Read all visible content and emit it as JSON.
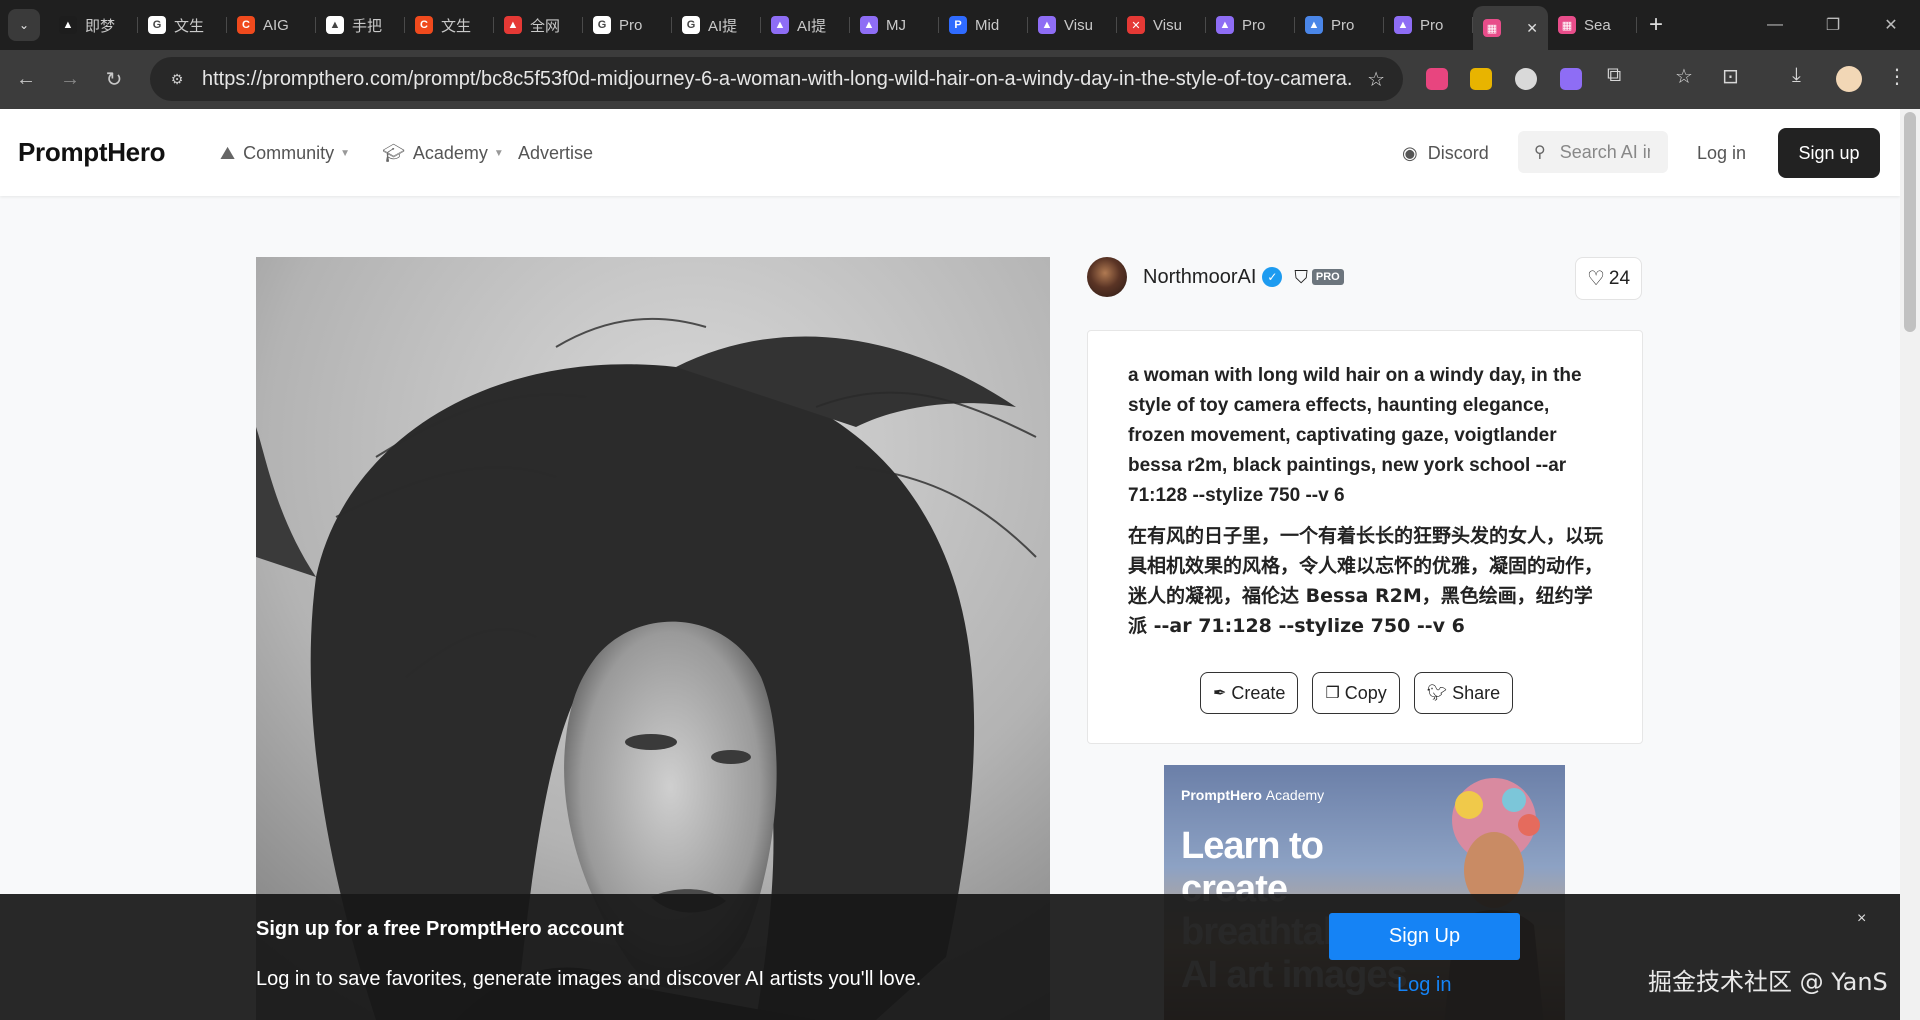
{
  "browser": {
    "tabs": [
      {
        "label": "即梦",
        "icon": "jimeng-icon",
        "color": "#1d1d1d"
      },
      {
        "label": "文生",
        "icon": "google-icon",
        "color": "#ffffff"
      },
      {
        "label": "AIG",
        "icon": "c-brand-icon",
        "color": "#f04a1d"
      },
      {
        "label": "手把",
        "icon": "aliyun-icon",
        "color": "#ffffff"
      },
      {
        "label": "文生",
        "icon": "c-brand-icon",
        "color": "#f04a1d"
      },
      {
        "label": "全网",
        "icon": "zhi-icon",
        "color": "#e53935"
      },
      {
        "label": "Pro",
        "icon": "google-icon",
        "color": "#ffffff"
      },
      {
        "label": "AI提",
        "icon": "google-icon",
        "color": "#ffffff"
      },
      {
        "label": "AI提",
        "icon": "prompt-logo-icon",
        "color": "#8e6df5"
      },
      {
        "label": "MJ",
        "icon": "prompt-logo-icon",
        "color": "#8e6df5"
      },
      {
        "label": "Mid",
        "icon": "p-brand-icon",
        "color": "#2f6bff"
      },
      {
        "label": "Visu",
        "icon": "prompt-logo-icon",
        "color": "#8e6df5"
      },
      {
        "label": "Visu",
        "icon": "x-brand-icon",
        "color": "#e53935"
      },
      {
        "label": "Pro",
        "icon": "prompt-logo-icon",
        "color": "#8e6df5"
      },
      {
        "label": "Pro",
        "icon": "globe-icon",
        "color": "#4a86e8"
      },
      {
        "label": "Pro",
        "icon": "prompt-logo-icon",
        "color": "#8e6df5"
      }
    ],
    "active_tab": {
      "label": "",
      "icon": "prompthero-icon",
      "color": "#e84d8a"
    },
    "last_tab": {
      "label": "Sea",
      "icon": "prompthero-icon",
      "color": "#e84d8a"
    },
    "url": "https://prompthero.com/prompt/bc8c5f53f0d-midjourney-6-a-woman-with-long-wild-hair-on-a-windy-day-in-the-style-of-toy-camera..."
  },
  "header": {
    "brand": "PromptHero",
    "nav": [
      {
        "label": "Community",
        "icon": "community-icon"
      },
      {
        "label": "Academy",
        "icon": "graduation-cap-icon"
      },
      {
        "label": "Advertise"
      }
    ],
    "discord": "Discord",
    "search_placeholder": "Search AI in",
    "login": "Log in",
    "signup": "Sign up"
  },
  "author": {
    "name": "NorthmoorAI",
    "pro": "PRO",
    "likes": "24"
  },
  "prompt": {
    "en": "a woman with long wild hair on a windy day, in the style of toy camera effects, haunting elegance, frozen movement, captivating gaze, voigtlander bessa r2m, black paintings, new york school --ar 71:128 --stylize 750 --v 6",
    "zh": "在有风的日子里，一个有着长长的狂野头发的女人，以玩具相机效果的风格，令人难以忘怀的优雅，凝固的动作，迷人的凝视，福伦达 Bessa R2M，黑色绘画，纽约学派 --ar 71:128 --stylize 750 --v 6",
    "actions": [
      {
        "label": "Create",
        "icon": "feather-icon"
      },
      {
        "label": "Copy",
        "icon": "copy-icon"
      },
      {
        "label": "Share",
        "icon": "twitter-icon"
      }
    ]
  },
  "ad": {
    "brand": "PromptHero",
    "brand_sub": "Academy",
    "headline": "Learn to create breathtaking AI art images"
  },
  "banner": {
    "title": "Sign up for a free PromptHero account",
    "text": "Log in to save favorites, generate images and discover AI artists you'll love.",
    "signup": "Sign Up",
    "login": "Log in",
    "close": "×"
  },
  "watermark": "掘金技术社区 @ YanS"
}
